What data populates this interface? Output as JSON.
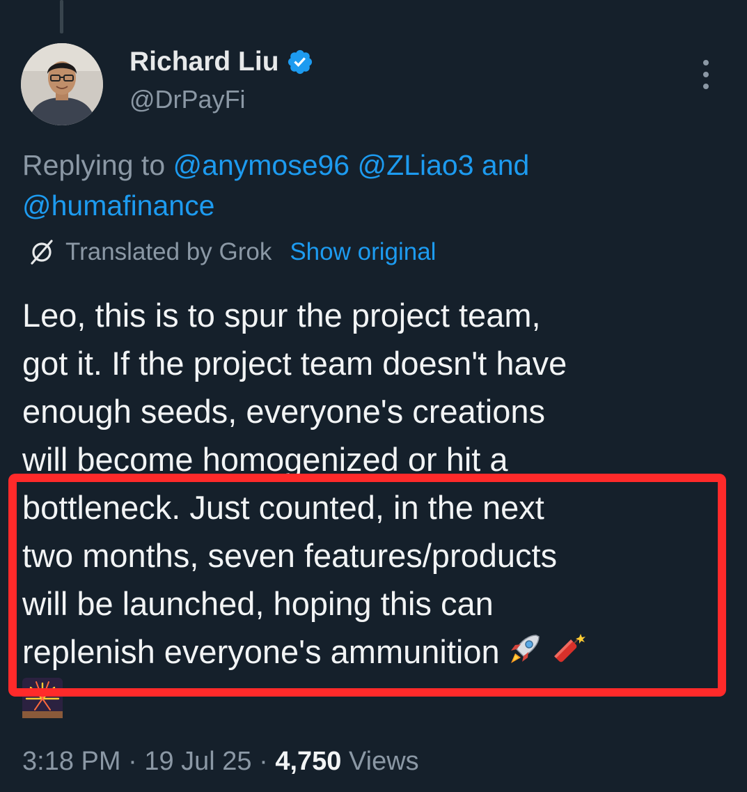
{
  "author": {
    "display_name": "Richard Liu",
    "handle": "@DrPayFi",
    "verified": true
  },
  "reply": {
    "prefix": "Replying to ",
    "mention_1": "@anymose96",
    "mention_2": "@ZLiao3",
    "conjunction": "and",
    "mention_3": "@humafinance"
  },
  "translation": {
    "label": "Translated by Grok",
    "show_original": "Show original"
  },
  "tweet": {
    "lines": [
      "Leo, this is to spur the project team,",
      "got it. If the project team doesn't have",
      "enough seeds, everyone's creations",
      "will become homogenized or hit a",
      "bottleneck. Just counted, in the next",
      "two months, seven features/products",
      "will be launched, hoping this can",
      "replenish everyone's ammunition"
    ],
    "emojis": [
      "rocket",
      "firecracker",
      "fireworks"
    ]
  },
  "meta": {
    "time": "3:18 PM",
    "separator": "·",
    "date": "19 Jul 25",
    "views_count": "4,750",
    "views_label": "Views"
  },
  "colors": {
    "background": "#15202b",
    "text": "#e7e9ea",
    "muted": "#8b98a5",
    "link": "#1d9bf0",
    "highlight": "#ff2a2a"
  }
}
